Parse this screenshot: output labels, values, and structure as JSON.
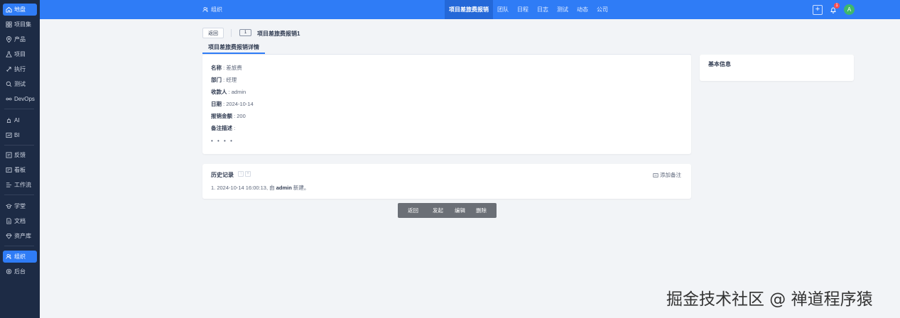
{
  "sidebar": {
    "items": [
      {
        "label": "地盘",
        "icon": "home-icon"
      },
      {
        "label": "项目集",
        "icon": "grid-icon"
      },
      {
        "label": "产品",
        "icon": "location-icon"
      },
      {
        "label": "项目",
        "icon": "flask-icon"
      },
      {
        "label": "执行",
        "icon": "rocket-icon"
      },
      {
        "label": "测试",
        "icon": "search-icon"
      },
      {
        "label": "DevOps",
        "icon": "infinity-icon"
      },
      {
        "label": "AI",
        "icon": "ai-icon"
      },
      {
        "label": "BI",
        "icon": "chart-icon"
      },
      {
        "label": "反馈",
        "icon": "feedback-icon"
      },
      {
        "label": "看板",
        "icon": "board-icon"
      },
      {
        "label": "工作流",
        "icon": "workflow-icon"
      },
      {
        "label": "学堂",
        "icon": "school-icon"
      },
      {
        "label": "文档",
        "icon": "doc-icon"
      },
      {
        "label": "资产库",
        "icon": "gem-icon"
      },
      {
        "label": "组织",
        "icon": "users-icon"
      },
      {
        "label": "后台",
        "icon": "gear-icon"
      }
    ]
  },
  "topbar": {
    "breadcrumb": "组织",
    "nav": [
      "项目差旅费报销",
      "团队",
      "日程",
      "日志",
      "测试",
      "动态",
      "公司"
    ],
    "notification_count": "1",
    "avatar_letter": "A",
    "accent_color": "#2f7cf6"
  },
  "header": {
    "back_label": "返回",
    "id_badge": "1",
    "title": "项目差旅费报销1"
  },
  "tabs": {
    "detail_tab": "项目差旅费报销详情"
  },
  "detail": {
    "fields": [
      {
        "label": "名称",
        "value": "差旅费"
      },
      {
        "label": "部门",
        "value": "经理"
      },
      {
        "label": "收款人",
        "value": "admin"
      },
      {
        "label": "日期",
        "value": "2024-10-14"
      },
      {
        "label": "报销金额",
        "value": "200"
      },
      {
        "label": "备注描述",
        "value": ""
      }
    ],
    "more": "• • • •"
  },
  "side_panel": {
    "title": "基本信息"
  },
  "history": {
    "title": "历史记录",
    "add_note": "添加备注",
    "entry_prefix": "1. 2024-10-14 16:00:13, 由 ",
    "entry_user": "admin",
    "entry_suffix": " 新建。"
  },
  "actions": {
    "back": "返回",
    "submit": "发起",
    "edit": "编辑",
    "delete": "删除"
  },
  "watermark": "掘金技术社区 @ 禅道程序猿"
}
